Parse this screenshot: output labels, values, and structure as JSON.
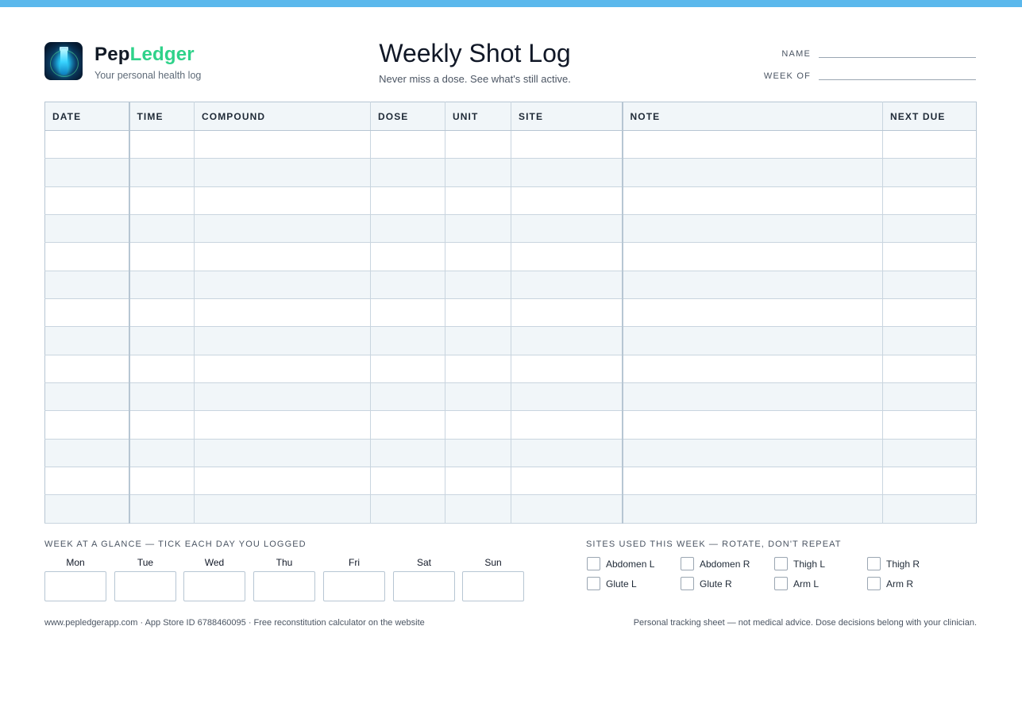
{
  "brand": {
    "name_part1": "Pep",
    "name_part2": "Ledger",
    "tagline": "Your personal health log",
    "accent": "#2fd28a",
    "top_bar_color": "#5bb8ec",
    "logo_icon": "vial-icon"
  },
  "header": {
    "title": "Weekly Shot Log",
    "subtitle": "Never miss a dose. See what's still active."
  },
  "fields": {
    "name_label": "NAME",
    "week_label": "WEEK OF"
  },
  "table": {
    "columns": [
      "DATE",
      "TIME",
      "COMPOUND",
      "DOSE",
      "UNIT",
      "SITE",
      "NOTE",
      "NEXT DUE"
    ],
    "row_count": 14,
    "alt_row_color": "#f1f6f9"
  },
  "week": {
    "label": "WEEK AT A GLANCE — TICK EACH DAY YOU LOGGED",
    "days": [
      "Mon",
      "Tue",
      "Wed",
      "Thu",
      "Fri",
      "Sat",
      "Sun"
    ]
  },
  "sites": {
    "label": "SITES USED THIS WEEK — ROTATE, DON'T REPEAT",
    "items": [
      "Abdomen L",
      "Abdomen R",
      "Thigh L",
      "Thigh R",
      "Glute L",
      "Glute R",
      "Arm L",
      "Arm R"
    ]
  },
  "footer": {
    "left": "www.pepledgerapp.com  ·  App Store ID 6788460095  ·  Free reconstitution calculator on the website",
    "right": "Personal tracking sheet — not medical advice. Dose decisions belong with your clinician."
  }
}
